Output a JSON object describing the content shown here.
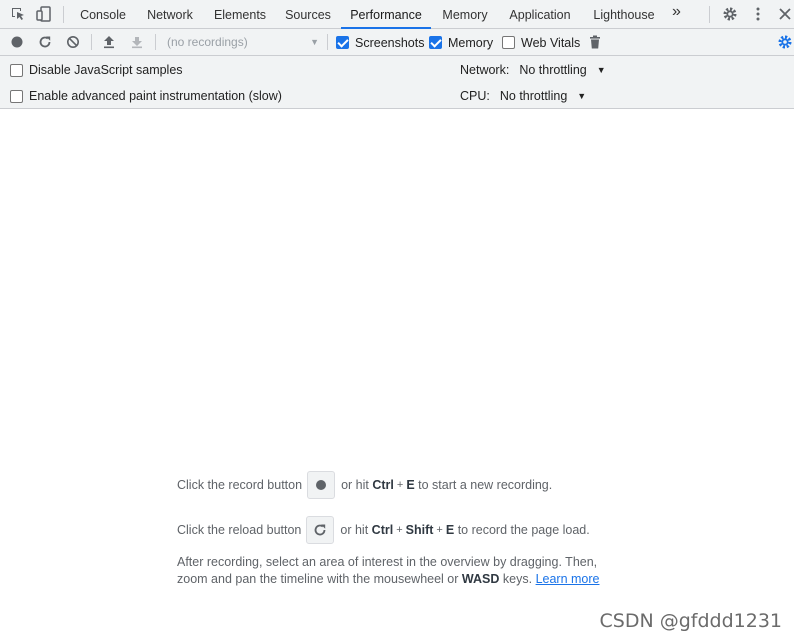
{
  "tabs": [
    {
      "label": "Console"
    },
    {
      "label": "Network"
    },
    {
      "label": "Elements"
    },
    {
      "label": "Sources"
    },
    {
      "label": "Performance",
      "active": true
    },
    {
      "label": "Memory"
    },
    {
      "label": "Application"
    },
    {
      "label": "Lighthouse"
    }
  ],
  "more_tabs_glyph": "»",
  "toolbar": {
    "recordings_placeholder": "(no recordings)",
    "screenshots_label": "Screenshots",
    "screenshots_checked": true,
    "memory_label": "Memory",
    "memory_checked": true,
    "web_vitals_label": "Web Vitals",
    "web_vitals_checked": false
  },
  "settings": {
    "disable_js_samples": "Disable JavaScript samples",
    "advanced_paint": "Enable advanced paint instrumentation (slow)",
    "network_label": "Network:",
    "network_value": "No throttling",
    "cpu_label": "CPU:",
    "cpu_value": "No throttling"
  },
  "landing": {
    "record_pre": "Click the record button",
    "record_mid": "or hit",
    "record_key1": "Ctrl",
    "record_plus": "+",
    "record_key2": "E",
    "record_post": "to start a new recording.",
    "reload_pre": "Click the reload button",
    "reload_mid": "or hit",
    "reload_key1": "Ctrl",
    "reload_plus1": "+",
    "reload_key2": "Shift",
    "reload_plus2": "+",
    "reload_key3": "E",
    "reload_post": "to record the page load.",
    "para_line1": "After recording, select an area of interest in the overview by dragging. Then,",
    "para_line2_a": "zoom and pan the timeline with the mousewheel or",
    "para_line2_b": "WASD",
    "para_line2_c": "keys.",
    "learn_more": "Learn more"
  },
  "watermark": "CSDN @gfddd1231",
  "colors": {
    "accent": "#1a73e8",
    "toolbar_bg": "#f1f3f4",
    "icon": "#5f6368"
  }
}
